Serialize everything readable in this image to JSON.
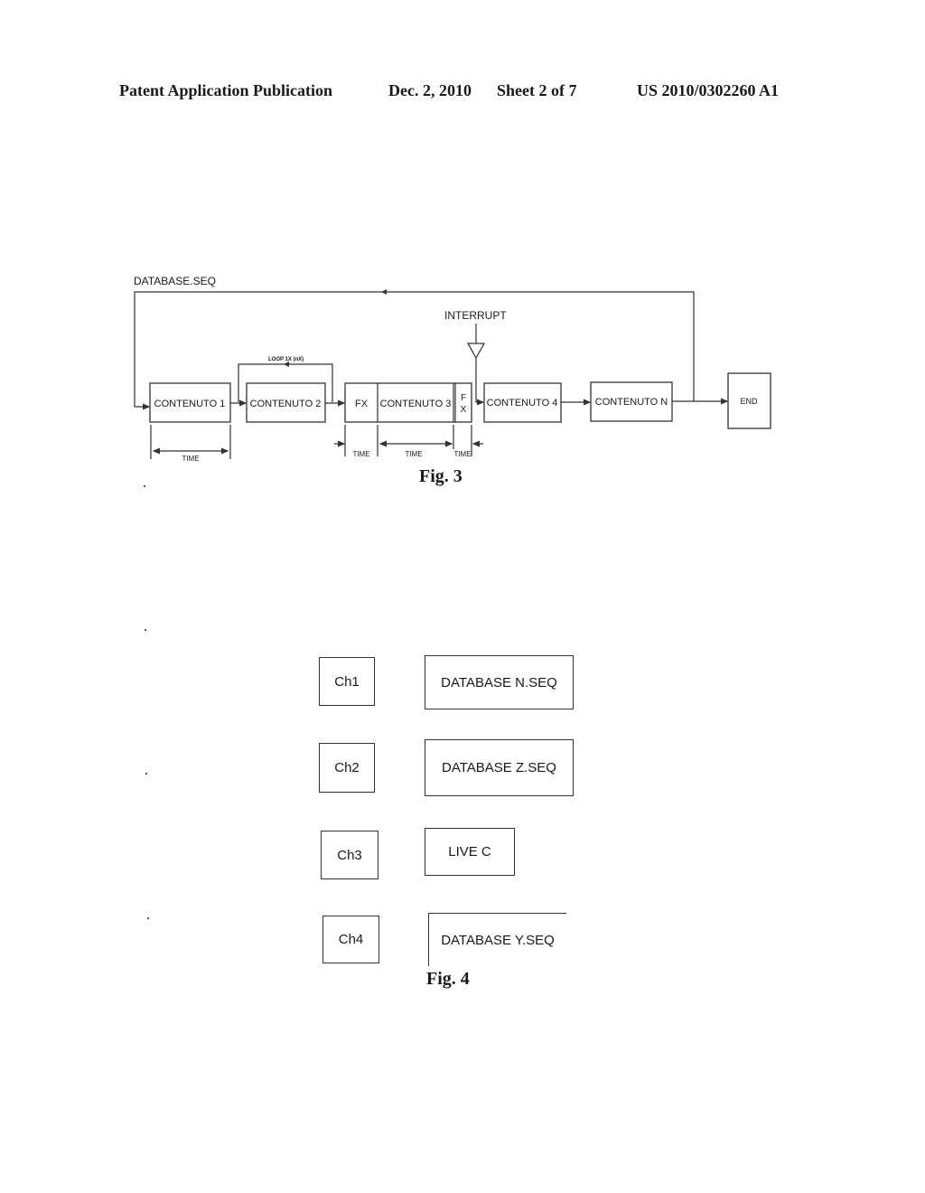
{
  "header": {
    "publication": "Patent Application Publication",
    "date": "Dec. 2, 2010",
    "sheet": "Sheet 2 of 7",
    "patent_number": "US 2010/0302260 A1"
  },
  "fig3": {
    "caption": "Fig. 3",
    "sequence_label": "DATABASE.SEQ",
    "interrupt_label": "INTERRUPT",
    "loop_label": "LOOP 1X (nX)",
    "blocks": {
      "contenuto1": "CONTENUTO 1",
      "contenuto2": "CONTENUTO 2",
      "fx_in": "FX",
      "contenuto3": "CONTENUTO 3",
      "fx_out_f": "F",
      "fx_out_x": "X",
      "contenuto4": "CONTENUTO 4",
      "contenutoN": "CONTENUTO N",
      "end": "END"
    },
    "time_labels": [
      "TIME",
      "TIME",
      "TIME",
      "TIME"
    ]
  },
  "fig4": {
    "caption": "Fig. 4",
    "rows": [
      {
        "channel": "Ch1",
        "source": "DATABASE N.SEQ"
      },
      {
        "channel": "Ch2",
        "source": "DATABASE Z.SEQ"
      },
      {
        "channel": "Ch3",
        "source": "LIVE C"
      },
      {
        "channel": "Ch4",
        "source": "DATABASE Y.SEQ"
      }
    ]
  }
}
